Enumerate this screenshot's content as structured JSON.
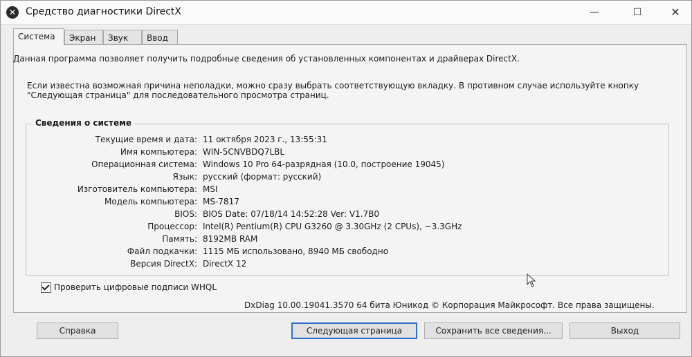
{
  "window": {
    "title": "Средство диагностики DirectX",
    "controls": {
      "minimize": "—",
      "maximize": "☐",
      "close": "✕"
    }
  },
  "tabs": [
    {
      "label": "Система",
      "active": true
    },
    {
      "label": "Экран",
      "active": false
    },
    {
      "label": "Звук",
      "active": false
    },
    {
      "label": "Ввод",
      "active": false
    }
  ],
  "intro": {
    "line1": "Данная программа позволяет получить подробные сведения об установленных компонентах и драйверах DirectX.",
    "line2": "Если известна возможная причина неполадки, можно сразу выбрать соответствующую вкладку. В противном случае используйте кнопку \"Следующая страница\" для последовательного просмотра страниц."
  },
  "system_info": {
    "title": "Сведения о системе",
    "rows": [
      {
        "label": "Текущие время и дата:",
        "value": "11 октября 2023 г., 13:55:31"
      },
      {
        "label": "Имя компьютера:",
        "value": "WIN-5CNVBDQ7LBL"
      },
      {
        "label": "Операционная система:",
        "value": "Windows 10 Pro 64-разрядная (10.0, построение 19045)"
      },
      {
        "label": "Язык:",
        "value": "русский (формат: русский)"
      },
      {
        "label": "Изготовитель компьютера:",
        "value": "MSI"
      },
      {
        "label": "Модель компьютера:",
        "value": "MS-7817"
      },
      {
        "label": "BIOS:",
        "value": "BIOS Date: 07/18/14 14:52:28 Ver: V1.7B0"
      },
      {
        "label": "Процессор:",
        "value": "Intel(R) Pentium(R) CPU G3260 @ 3.30GHz (2 CPUs), ~3.3GHz"
      },
      {
        "label": "Память:",
        "value": "8192MB RAM"
      },
      {
        "label": "Файл подкачки:",
        "value": "1115 МБ использовано, 8940 МБ свободно"
      },
      {
        "label": "Версия DirectX:",
        "value": "DirectX 12"
      }
    ]
  },
  "whql": {
    "label": "Проверить цифровые подписи WHQL",
    "checked": true
  },
  "footer": {
    "copyright": "DxDiag 10.00.19041.3570 64 бита Юникод © Корпорация Майкрософт. Все права защищены."
  },
  "buttons": {
    "help": "Справка",
    "next": "Следующая страница",
    "save": "Сохранить все сведения...",
    "exit": "Выход"
  }
}
